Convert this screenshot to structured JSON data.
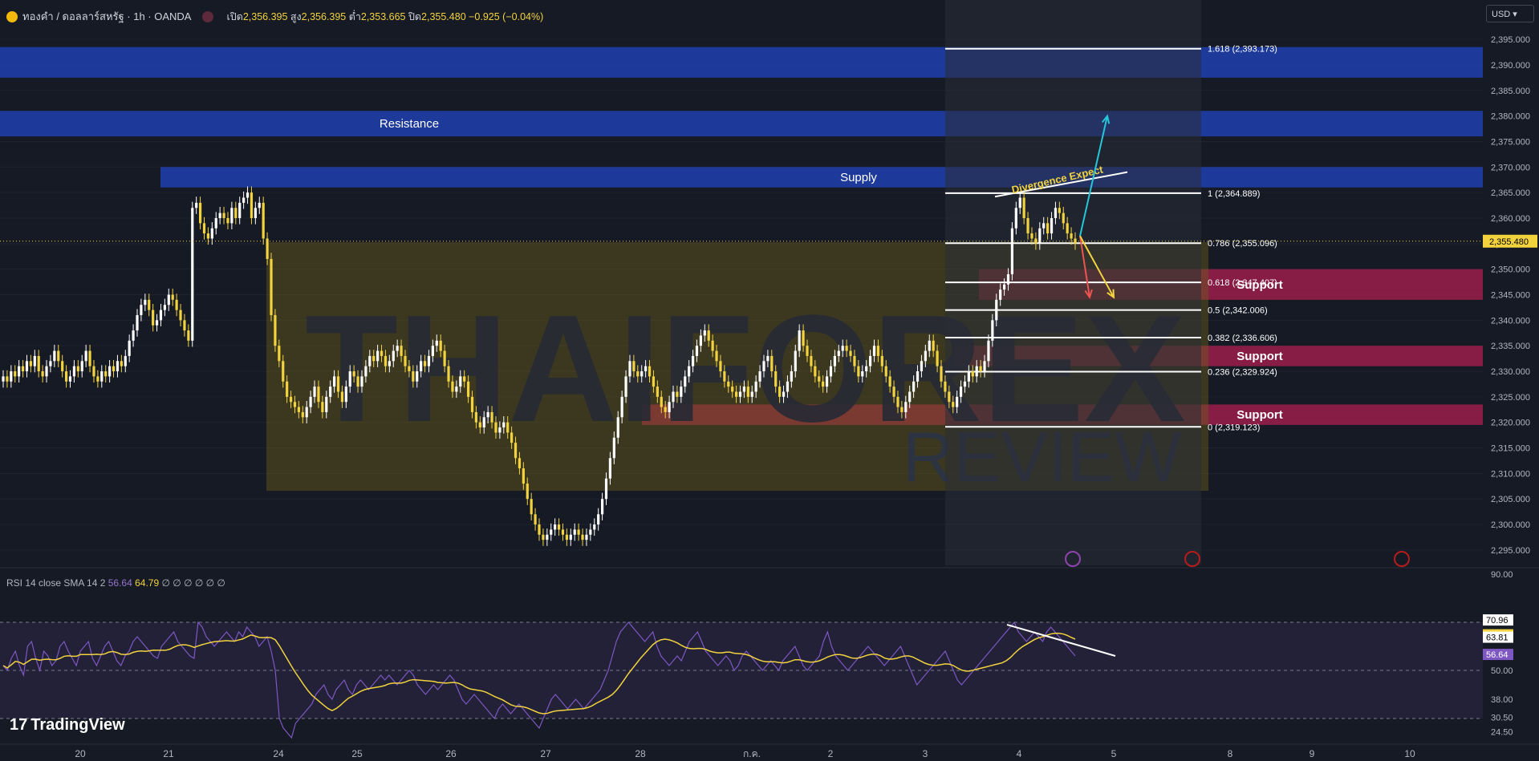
{
  "header": {
    "symbol": "ทองคำ / ดอลลาร์สหรัฐ · 1h · OANDA",
    "ohlc_open_label": "เปิด",
    "ohlc_open": "2,356.395",
    "ohlc_high_label": "สูง",
    "ohlc_high": "2,356.395",
    "ohlc_low_label": "ต่ำ",
    "ohlc_low": "2,353.665",
    "ohlc_close_label": "ปิด",
    "ohlc_close": "2,355.480",
    "ohlc_change": "−0.925 (−0.04%)",
    "currency": "USD"
  },
  "rsi_legend": {
    "label": "RSI 14 close SMA 14 2",
    "rsi_value": "56.64",
    "sma_value": "64.79",
    "extras": "∅ ∅ ∅ ∅ ∅ ∅"
  },
  "brand": {
    "name": "TradingView"
  },
  "watermark": {
    "line1": "THAIFOREX",
    "line2": "REVIEW"
  },
  "colors": {
    "background": "#161a25",
    "bull_candle": "#ffffff",
    "bear_candle": "#f2d33e",
    "zone_blue": "#1e40af",
    "zone_red": "#9b1f4a",
    "rsi_line": "#7e57c2",
    "rsi_sma": "#f2d33e",
    "price_badge": "#f2d33e"
  },
  "chart_data": {
    "type": "candlestick",
    "title": "ทองคำ / ดอลลาร์สหรัฐ · 1h · OANDA",
    "price_axis": {
      "ticks": [
        2395,
        2390,
        2385,
        2380,
        2375,
        2370,
        2365,
        2360,
        2355,
        2350,
        2345,
        2340,
        2335,
        2330,
        2325,
        2320,
        2315,
        2310,
        2305,
        2300,
        2295
      ],
      "tick_labels": [
        "2,395.000",
        "2,390.000",
        "2,385.000",
        "2,380.000",
        "2,375.000",
        "2,370.000",
        "2,365.000",
        "2,360.000",
        "2,355.000",
        "2,350.000",
        "2,345.000",
        "2,340.000",
        "2,335.000",
        "2,330.000",
        "2,325.000",
        "2,320.000",
        "2,315.000",
        "2,310.000",
        "2,305.000",
        "2,300.000",
        "2,295.000"
      ],
      "range": [
        2292,
        2398
      ],
      "current_price": 2355.48,
      "current_price_label": "2,355.480"
    },
    "time_axis": {
      "labels": [
        "20",
        "21",
        "24",
        "25",
        "26",
        "27",
        "28",
        "ก.ค.",
        "2",
        "3",
        "4",
        "5",
        "8",
        "9",
        "10"
      ],
      "positions": [
        20,
        21,
        24,
        25,
        26,
        27,
        28,
        29,
        30,
        31,
        32,
        33,
        34,
        35,
        36
      ]
    },
    "candles_close": [
      2329,
      2328,
      2330,
      2329,
      2331,
      2330,
      2332,
      2331,
      2333,
      2330,
      2329,
      2331,
      2332,
      2334,
      2332,
      2330,
      2328,
      2329,
      2331,
      2330,
      2332,
      2334,
      2331,
      2329,
      2328,
      2330,
      2329,
      2331,
      2330,
      2332,
      2331,
      2333,
      2336,
      2338,
      2341,
      2343,
      2344,
      2342,
      2339,
      2340,
      2342,
      2343,
      2345,
      2344,
      2342,
      2340,
      2338,
      2336,
      2362,
      2363,
      2359,
      2357,
      2356,
      2358,
      2360,
      2361,
      2360,
      2359,
      2362,
      2360,
      2363,
      2364,
      2365,
      2360,
      2362,
      2363,
      2356,
      2352,
      2341,
      2335,
      2332,
      2328,
      2325,
      2324,
      2323,
      2322,
      2321,
      2323,
      2325,
      2327,
      2324,
      2322,
      2325,
      2327,
      2329,
      2326,
      2324,
      2327,
      2330,
      2329,
      2327,
      2329,
      2331,
      2333,
      2332,
      2334,
      2333,
      2331,
      2332,
      2334,
      2335,
      2333,
      2331,
      2330,
      2328,
      2330,
      2332,
      2331,
      2333,
      2335,
      2336,
      2334,
      2331,
      2328,
      2326,
      2327,
      2329,
      2328,
      2325,
      2322,
      2320,
      2319,
      2321,
      2322,
      2320,
      2318,
      2319,
      2320,
      2318,
      2316,
      2313,
      2311,
      2308,
      2305,
      2302,
      2300,
      2298,
      2297,
      2298,
      2299,
      2300,
      2299,
      2298,
      2297,
      2298,
      2299,
      2298,
      2297,
      2298,
      2299,
      2300,
      2302,
      2305,
      2309,
      2313,
      2317,
      2321,
      2325,
      2329,
      2332,
      2330,
      2329,
      2330,
      2331,
      2329,
      2327,
      2325,
      2323,
      2322,
      2324,
      2326,
      2325,
      2327,
      2329,
      2331,
      2333,
      2335,
      2337,
      2338,
      2336,
      2334,
      2332,
      2330,
      2328,
      2327,
      2326,
      2325,
      2326,
      2327,
      2325,
      2326,
      2328,
      2330,
      2332,
      2333,
      2330,
      2327,
      2325,
      2326,
      2328,
      2330,
      2334,
      2338,
      2335,
      2333,
      2331,
      2329,
      2328,
      2327,
      2329,
      2331,
      2333,
      2334,
      2335,
      2334,
      2333,
      2331,
      2329,
      2330,
      2331,
      2333,
      2335,
      2333,
      2331,
      2329,
      2327,
      2325,
      2323,
      2322,
      2324,
      2326,
      2328,
      2330,
      2332,
      2334,
      2336,
      2334,
      2331,
      2328,
      2326,
      2324,
      2323,
      2325,
      2327,
      2328,
      2330,
      2329,
      2331,
      2330,
      2332,
      2336,
      2340,
      2344,
      2346,
      2347,
      2349,
      2358,
      2362,
      2364,
      2360,
      2357,
      2356,
      2355,
      2358,
      2359,
      2357,
      2360,
      2362,
      2361,
      2359,
      2357,
      2356,
      2355
    ],
    "rsi": [
      52,
      50,
      55,
      58,
      52,
      48,
      60,
      62,
      55,
      50,
      58,
      56,
      52,
      54,
      60,
      62,
      58,
      55,
      52,
      58,
      60,
      62,
      55,
      52,
      56,
      60,
      62,
      58,
      54,
      52,
      56,
      58,
      62,
      64,
      62,
      60,
      58,
      56,
      55,
      60,
      62,
      64,
      66,
      62,
      60,
      58,
      56,
      55,
      70,
      68,
      64,
      62,
      60,
      62,
      64,
      66,
      64,
      62,
      66,
      64,
      68,
      66,
      64,
      60,
      62,
      64,
      58,
      50,
      30,
      26,
      24,
      22,
      28,
      30,
      32,
      34,
      36,
      40,
      42,
      44,
      40,
      38,
      42,
      44,
      46,
      42,
      40,
      44,
      46,
      44,
      42,
      44,
      46,
      48,
      46,
      48,
      46,
      44,
      46,
      48,
      50,
      48,
      44,
      42,
      40,
      42,
      44,
      42,
      44,
      46,
      48,
      46,
      42,
      38,
      36,
      38,
      40,
      38,
      36,
      34,
      32,
      30,
      34,
      36,
      34,
      32,
      34,
      36,
      34,
      32,
      30,
      28,
      26,
      30,
      34,
      38,
      40,
      38,
      36,
      34,
      36,
      38,
      36,
      34,
      36,
      38,
      40,
      42,
      46,
      50,
      56,
      62,
      66,
      68,
      70,
      68,
      66,
      64,
      62,
      64,
      66,
      60,
      56,
      54,
      52,
      54,
      56,
      54,
      58,
      62,
      64,
      66,
      62,
      58,
      56,
      54,
      52,
      54,
      56,
      54,
      50,
      52,
      56,
      58,
      56,
      54,
      52,
      50,
      52,
      54,
      52,
      50,
      54,
      56,
      58,
      60,
      56,
      52,
      50,
      52,
      54,
      56,
      62,
      66,
      60,
      56,
      54,
      52,
      50,
      52,
      54,
      56,
      58,
      60,
      58,
      56,
      54,
      52,
      54,
      56,
      58,
      60,
      56,
      52,
      48,
      44,
      46,
      48,
      50,
      52,
      54,
      56,
      58,
      54,
      50,
      46,
      44,
      46,
      48,
      50,
      52,
      54,
      56,
      58,
      60,
      62,
      64,
      66,
      68,
      70,
      66,
      64,
      62,
      64,
      66,
      64,
      62,
      66,
      68,
      66,
      64,
      62,
      60,
      58,
      56
    ],
    "rsi_axis": {
      "ticks": [
        90,
        70.96,
        64.79,
        63.81,
        56.64,
        50,
        38,
        30.5,
        24.5
      ],
      "tick_labels": [
        "90.00",
        "70.96",
        "64.79",
        "63.81",
        "56.64",
        "50.00",
        "38.00",
        "30.50",
        "24.50"
      ],
      "range": [
        22,
        92
      ],
      "upper_band": 70,
      "lower_band": 30
    },
    "zones": [
      {
        "type": "resistance",
        "label": "",
        "lo": 2387.5,
        "hi": 2393.5
      },
      {
        "type": "resistance",
        "label": "Resistance",
        "lo": 2376,
        "hi": 2381
      },
      {
        "type": "supply",
        "label": "Supply",
        "lo": 2366,
        "hi": 2370
      },
      {
        "type": "support",
        "label": "Support",
        "lo": 2344,
        "hi": 2350
      },
      {
        "type": "support",
        "label": "Support",
        "lo": 2331,
        "hi": 2335
      },
      {
        "type": "support",
        "label": "Support",
        "lo": 2319.5,
        "hi": 2323.5
      }
    ],
    "fibonacci": [
      {
        "ratio": "1.618",
        "price": 2393.173,
        "label": "1.618 (2,393.173)"
      },
      {
        "ratio": "1",
        "price": 2364.889,
        "label": "1 (2,364.889)"
      },
      {
        "ratio": "0.786",
        "price": 2355.096,
        "label": "0.786 (2,355.096)"
      },
      {
        "ratio": "0.618",
        "price": 2347.407,
        "label": "0.618 (2,347.407)"
      },
      {
        "ratio": "0.5",
        "price": 2342.006,
        "label": "0.5 (2,342.006)"
      },
      {
        "ratio": "0.382",
        "price": 2336.606,
        "label": "0.382 (2,336.606)"
      },
      {
        "ratio": "0.236",
        "price": 2329.924,
        "label": "0.236 (2,329.924)"
      },
      {
        "ratio": "0",
        "price": 2319.123,
        "label": "0 (2,319.123)"
      }
    ],
    "annotations": [
      {
        "text": "Divergence Expect"
      }
    ]
  }
}
